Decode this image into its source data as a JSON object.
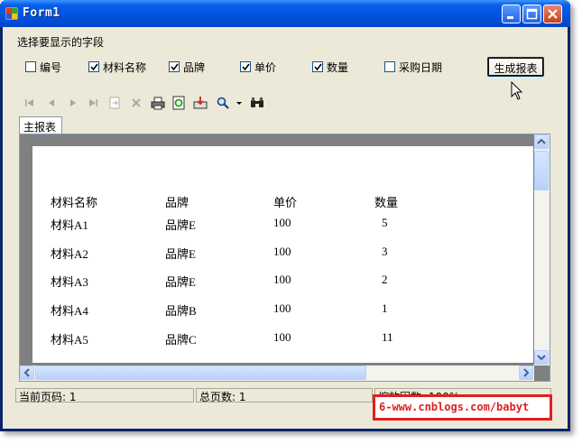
{
  "window": {
    "title": "Form1"
  },
  "fields_label": "选择要显示的字段",
  "checkboxes": [
    {
      "label": "编号",
      "checked": false
    },
    {
      "label": "材料名称",
      "checked": true
    },
    {
      "label": "品牌",
      "checked": true
    },
    {
      "label": "单价",
      "checked": true
    },
    {
      "label": "数量",
      "checked": true
    },
    {
      "label": "采购日期",
      "checked": false
    }
  ],
  "generate_button": "生成报表",
  "toolbar_icons": [
    "first-page-icon",
    "prev-page-icon",
    "next-page-icon",
    "last-page-icon",
    "export-icon",
    "close-icon",
    "print-icon",
    "refresh-icon",
    "export-file-icon",
    "zoom-icon",
    "dropdown-icon",
    "search-icon"
  ],
  "tab": {
    "label": "主报表"
  },
  "report": {
    "headers": [
      "材料名称",
      "品牌",
      "单价",
      "数量"
    ],
    "rows": [
      [
        "材料A1",
        "品牌E",
        "100",
        "5"
      ],
      [
        "材料A2",
        "品牌E",
        "100",
        "3"
      ],
      [
        "材料A3",
        "品牌E",
        "100",
        "2"
      ],
      [
        "材料A4",
        "品牌B",
        "100",
        "1"
      ],
      [
        "材料A5",
        "品牌C",
        "100",
        "11"
      ]
    ]
  },
  "status": {
    "current_page": "当前页码: 1",
    "total_pages": "总页数: 1",
    "zoom": "缩放因数: 100%"
  },
  "watermark": "6-www.cnblogs.com/babyt"
}
